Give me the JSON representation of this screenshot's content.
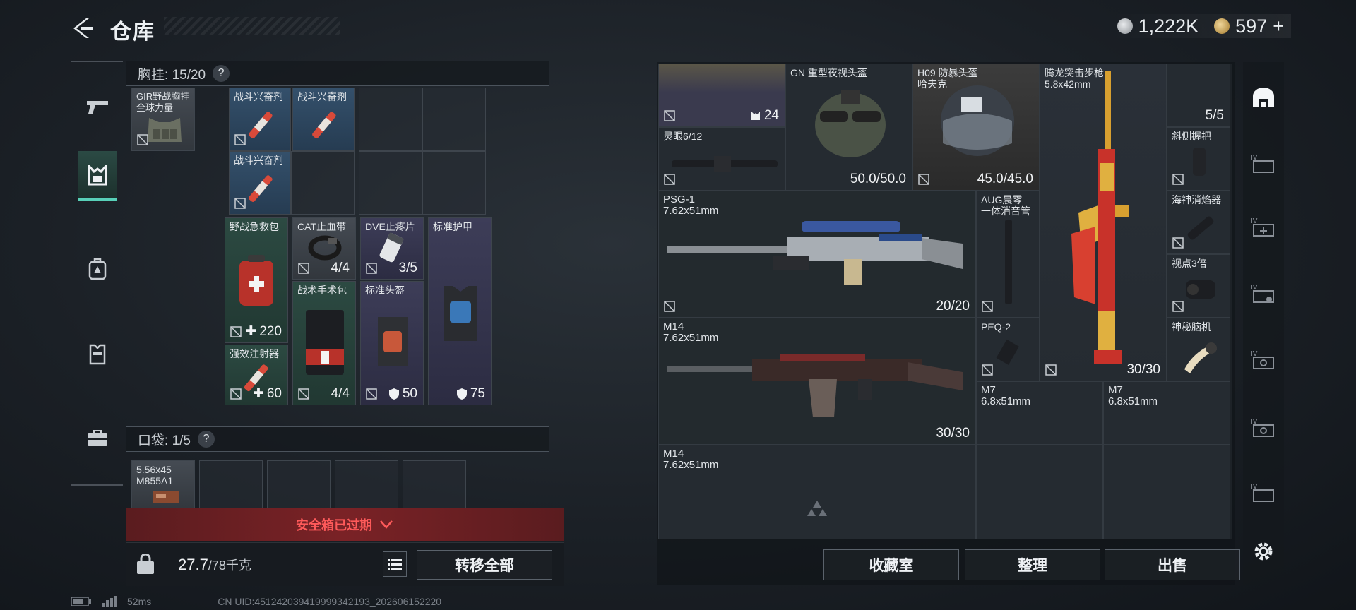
{
  "header": {
    "title": "仓库",
    "currency_silver": "1,222K",
    "currency_gold": "597",
    "currency_gold_plus": "+"
  },
  "left": {
    "chest_rig": {
      "label": "胸挂",
      "count": "15/20",
      "help": "?"
    },
    "pocket": {
      "label": "口袋",
      "count": "1/5",
      "help": "?"
    },
    "items": {
      "rig": {
        "name": "GIR野战胸挂\n全球力量"
      },
      "stim1": {
        "name": "战斗兴奋剂"
      },
      "stim2": {
        "name": "战斗兴奋剂"
      },
      "stim3": {
        "name": "战斗兴奋剂"
      },
      "medkit": {
        "name": "野战急救包",
        "qty": "220"
      },
      "tourniquet": {
        "name": "CAT止血带",
        "qty": "4/4"
      },
      "dve": {
        "name": "DVE止疼片",
        "qty": "3/5"
      },
      "armor": {
        "name": "标准护甲",
        "qty": "75"
      },
      "surgical": {
        "name": "战术手术包",
        "qty": "4/4"
      },
      "helmet": {
        "name": "标准头盔",
        "qty": "50"
      },
      "injector": {
        "name": "强效注射器",
        "qty": "60"
      },
      "ammo": {
        "name": "5.56x45\nM855A1"
      }
    },
    "expired_label": "安全箱已过期",
    "weight_value": "27.7",
    "weight_max": "/78千克",
    "transfer_all": "转移全部"
  },
  "right": {
    "items": {
      "nv_helmet": {
        "name": "GN 重型夜视头盔",
        "qty": "50.0/50.0"
      },
      "h09_helmet": {
        "name": "H09 防暴头盔\n哈夫克",
        "qty": "45.0/45.0"
      },
      "dragon_rifle": {
        "name": "腾龙突击步枪\n5.8x42mm",
        "qty": "30/30"
      },
      "top_left": {
        "qty": "24"
      },
      "top_right": {
        "qty": "5/5"
      },
      "scope": {
        "name": "灵眼6/12"
      },
      "grip": {
        "name": "斜侧握把"
      },
      "psg1": {
        "name": "PSG-1\n7.62x51mm",
        "qty": "20/20"
      },
      "aug_supp": {
        "name": "AUG晨零\n一体消音管"
      },
      "poseidon": {
        "name": "海神消焰器"
      },
      "sight3x": {
        "name": "视点3倍"
      },
      "m14a": {
        "name": "M14\n7.62x51mm",
        "qty": "30/30"
      },
      "peq2": {
        "name": "PEQ-2"
      },
      "mystery": {
        "name": "神秘脑机"
      },
      "m7a": {
        "name": "M7\n6.8x51mm"
      },
      "m7b": {
        "name": "M7\n6.8x51mm"
      },
      "m14b": {
        "name": "M14\n7.62x51mm"
      }
    },
    "buttons": {
      "collection": "收藏室",
      "sort": "整理",
      "sell": "出售"
    }
  },
  "status": {
    "ping": "52ms",
    "uid": "CN UID:451242039419999342193_202606152220"
  },
  "colors": {
    "accent": "#58d0b8",
    "expired": "#ff5a5a",
    "gold": "#e0c070"
  }
}
